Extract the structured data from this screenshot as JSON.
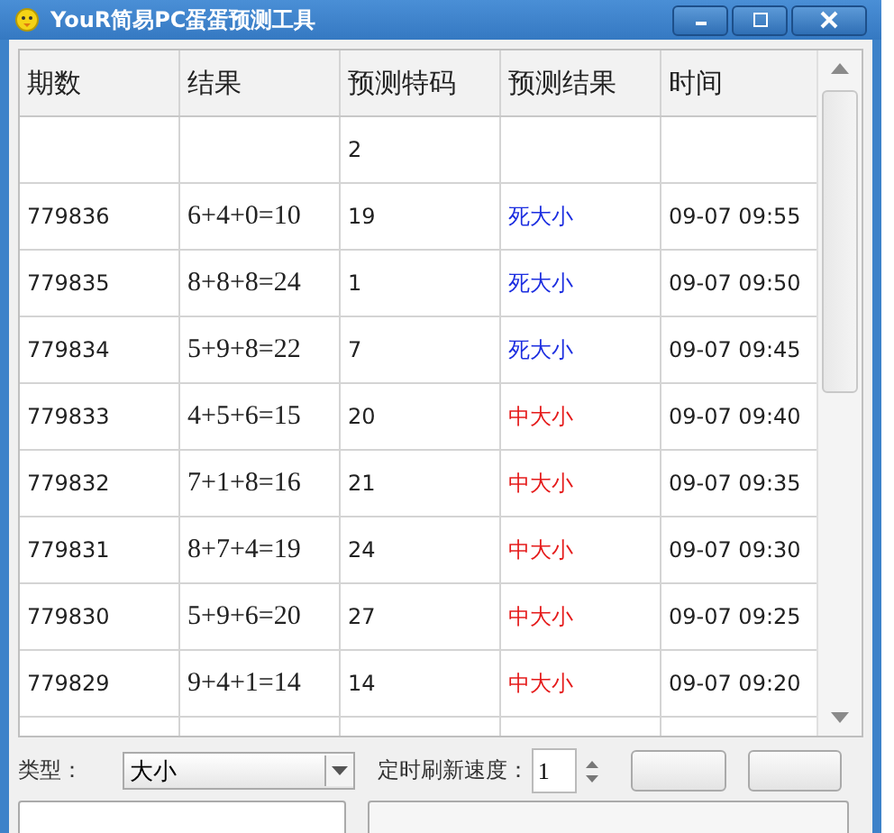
{
  "window": {
    "title": "YouR简易PC蛋蛋预测工具"
  },
  "table": {
    "columns": [
      "期数",
      "结果",
      "预测特码",
      "预测结果",
      "时间"
    ],
    "rows": [
      {
        "period": "",
        "result": "",
        "code": "2",
        "prediction": "",
        "time": ""
      },
      {
        "period": "779836",
        "result": "6+4+0=10",
        "code": "19",
        "prediction": "死大小",
        "color": "#1c2ee0",
        "time": "09-07 09:55"
      },
      {
        "period": "779835",
        "result": "8+8+8=24",
        "code": "1",
        "prediction": "死大小",
        "color": "#1c2ee0",
        "time": "09-07 09:50"
      },
      {
        "period": "779834",
        "result": "5+9+8=22",
        "code": "7",
        "prediction": "死大小",
        "color": "#1c2ee0",
        "time": "09-07 09:45"
      },
      {
        "period": "779833",
        "result": "4+5+6=15",
        "code": "20",
        "prediction": "中大小",
        "color": "#e51b1b",
        "time": "09-07 09:40"
      },
      {
        "period": "779832",
        "result": "7+1+8=16",
        "code": "21",
        "prediction": "中大小",
        "color": "#e51b1b",
        "time": "09-07 09:35"
      },
      {
        "period": "779831",
        "result": "8+7+4=19",
        "code": "24",
        "prediction": "中大小",
        "color": "#e51b1b",
        "time": "09-07 09:30"
      },
      {
        "period": "779830",
        "result": "5+9+6=20",
        "code": "27",
        "prediction": "中大小",
        "color": "#e51b1b",
        "time": "09-07 09:25"
      },
      {
        "period": "779829",
        "result": "9+4+1=14",
        "code": "14",
        "prediction": "中大小",
        "color": "#e51b1b",
        "time": "09-07 09:20"
      }
    ]
  },
  "controls": {
    "type_label": "类型：",
    "type_value": "大小",
    "speed_label": "定时刷新速度：",
    "speed_value": "1"
  }
}
